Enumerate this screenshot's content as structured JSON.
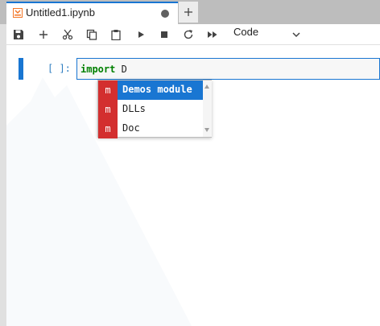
{
  "tab": {
    "title": "Untitled1.ipynb",
    "icon": "notebook-icon",
    "status": "unsaved-dot-icon"
  },
  "new_tab": {
    "icon": "plus-icon"
  },
  "toolbar": {
    "buttons": [
      "save-icon",
      "plus-icon",
      "cut-icon",
      "copy-icon",
      "paste-icon",
      "run-icon",
      "stop-icon",
      "restart-icon",
      "fast-forward-icon"
    ],
    "cell_type": "Code",
    "cell_type_icon": "chevron-down-icon"
  },
  "cell": {
    "prompt": "[ ]:",
    "code_keyword": "import",
    "code_rest": " D"
  },
  "completer": {
    "items": [
      {
        "type": "m",
        "label": "Demos module",
        "active": true
      },
      {
        "type": "m",
        "label": "DLLs",
        "active": false
      },
      {
        "type": "m",
        "label": "Doc",
        "active": false
      }
    ]
  },
  "colors": {
    "accent": "#1976d2",
    "completer_type": "#d32f2f",
    "keyword": "#008000"
  }
}
